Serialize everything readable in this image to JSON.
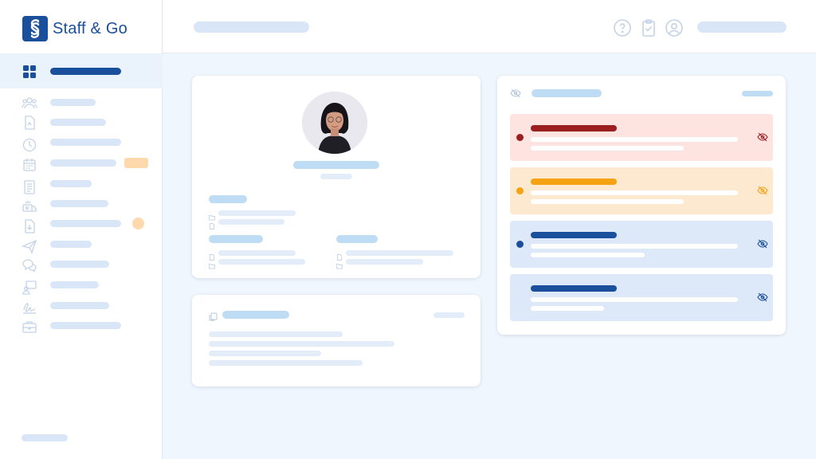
{
  "app": {
    "brand_name": "Staff & Go"
  },
  "colors": {
    "brand": "#1a4f9c",
    "error_bg": "#fde4e1",
    "error_accent": "#9b1f1f",
    "warning_bg": "#fde9d0",
    "warning_accent": "#f6a313",
    "info_bg": "#dde8f8",
    "info_accent": "#1a4f9c",
    "placeholder": "#d8e6f7",
    "nav_badge": "#fdd9ab"
  },
  "sidebar": {
    "items": [
      {
        "icon": "dashboard-grid-icon",
        "active": true
      },
      {
        "icon": "team-users-icon"
      },
      {
        "icon": "document-file-icon"
      },
      {
        "icon": "clock-icon"
      },
      {
        "icon": "calendar-icon",
        "badge": "pill"
      },
      {
        "icon": "list-document-icon"
      },
      {
        "icon": "money-truck-icon"
      },
      {
        "icon": "file-download-icon",
        "badge": "dot"
      },
      {
        "icon": "send-paper-plane-icon"
      },
      {
        "icon": "chat-bubbles-icon"
      },
      {
        "icon": "presentation-user-icon"
      },
      {
        "icon": "signature-icon"
      },
      {
        "icon": "briefcase-icon"
      }
    ]
  },
  "header": {
    "icons": [
      "help-circle-icon",
      "clipboard-check-icon",
      "user-account-icon"
    ]
  },
  "profile_card": {
    "avatar": "profile-photo"
  },
  "notes_card": {
    "icon": "copy-icon"
  },
  "alerts_card": {
    "icon": "eye-off-icon",
    "alerts": [
      {
        "severity": "error",
        "icon": "eye-off-icon"
      },
      {
        "severity": "warning",
        "icon": "eye-off-icon"
      },
      {
        "severity": "info",
        "icon": "eye-off-icon"
      },
      {
        "severity": "neutral",
        "icon": "eye-off-icon"
      }
    ]
  }
}
